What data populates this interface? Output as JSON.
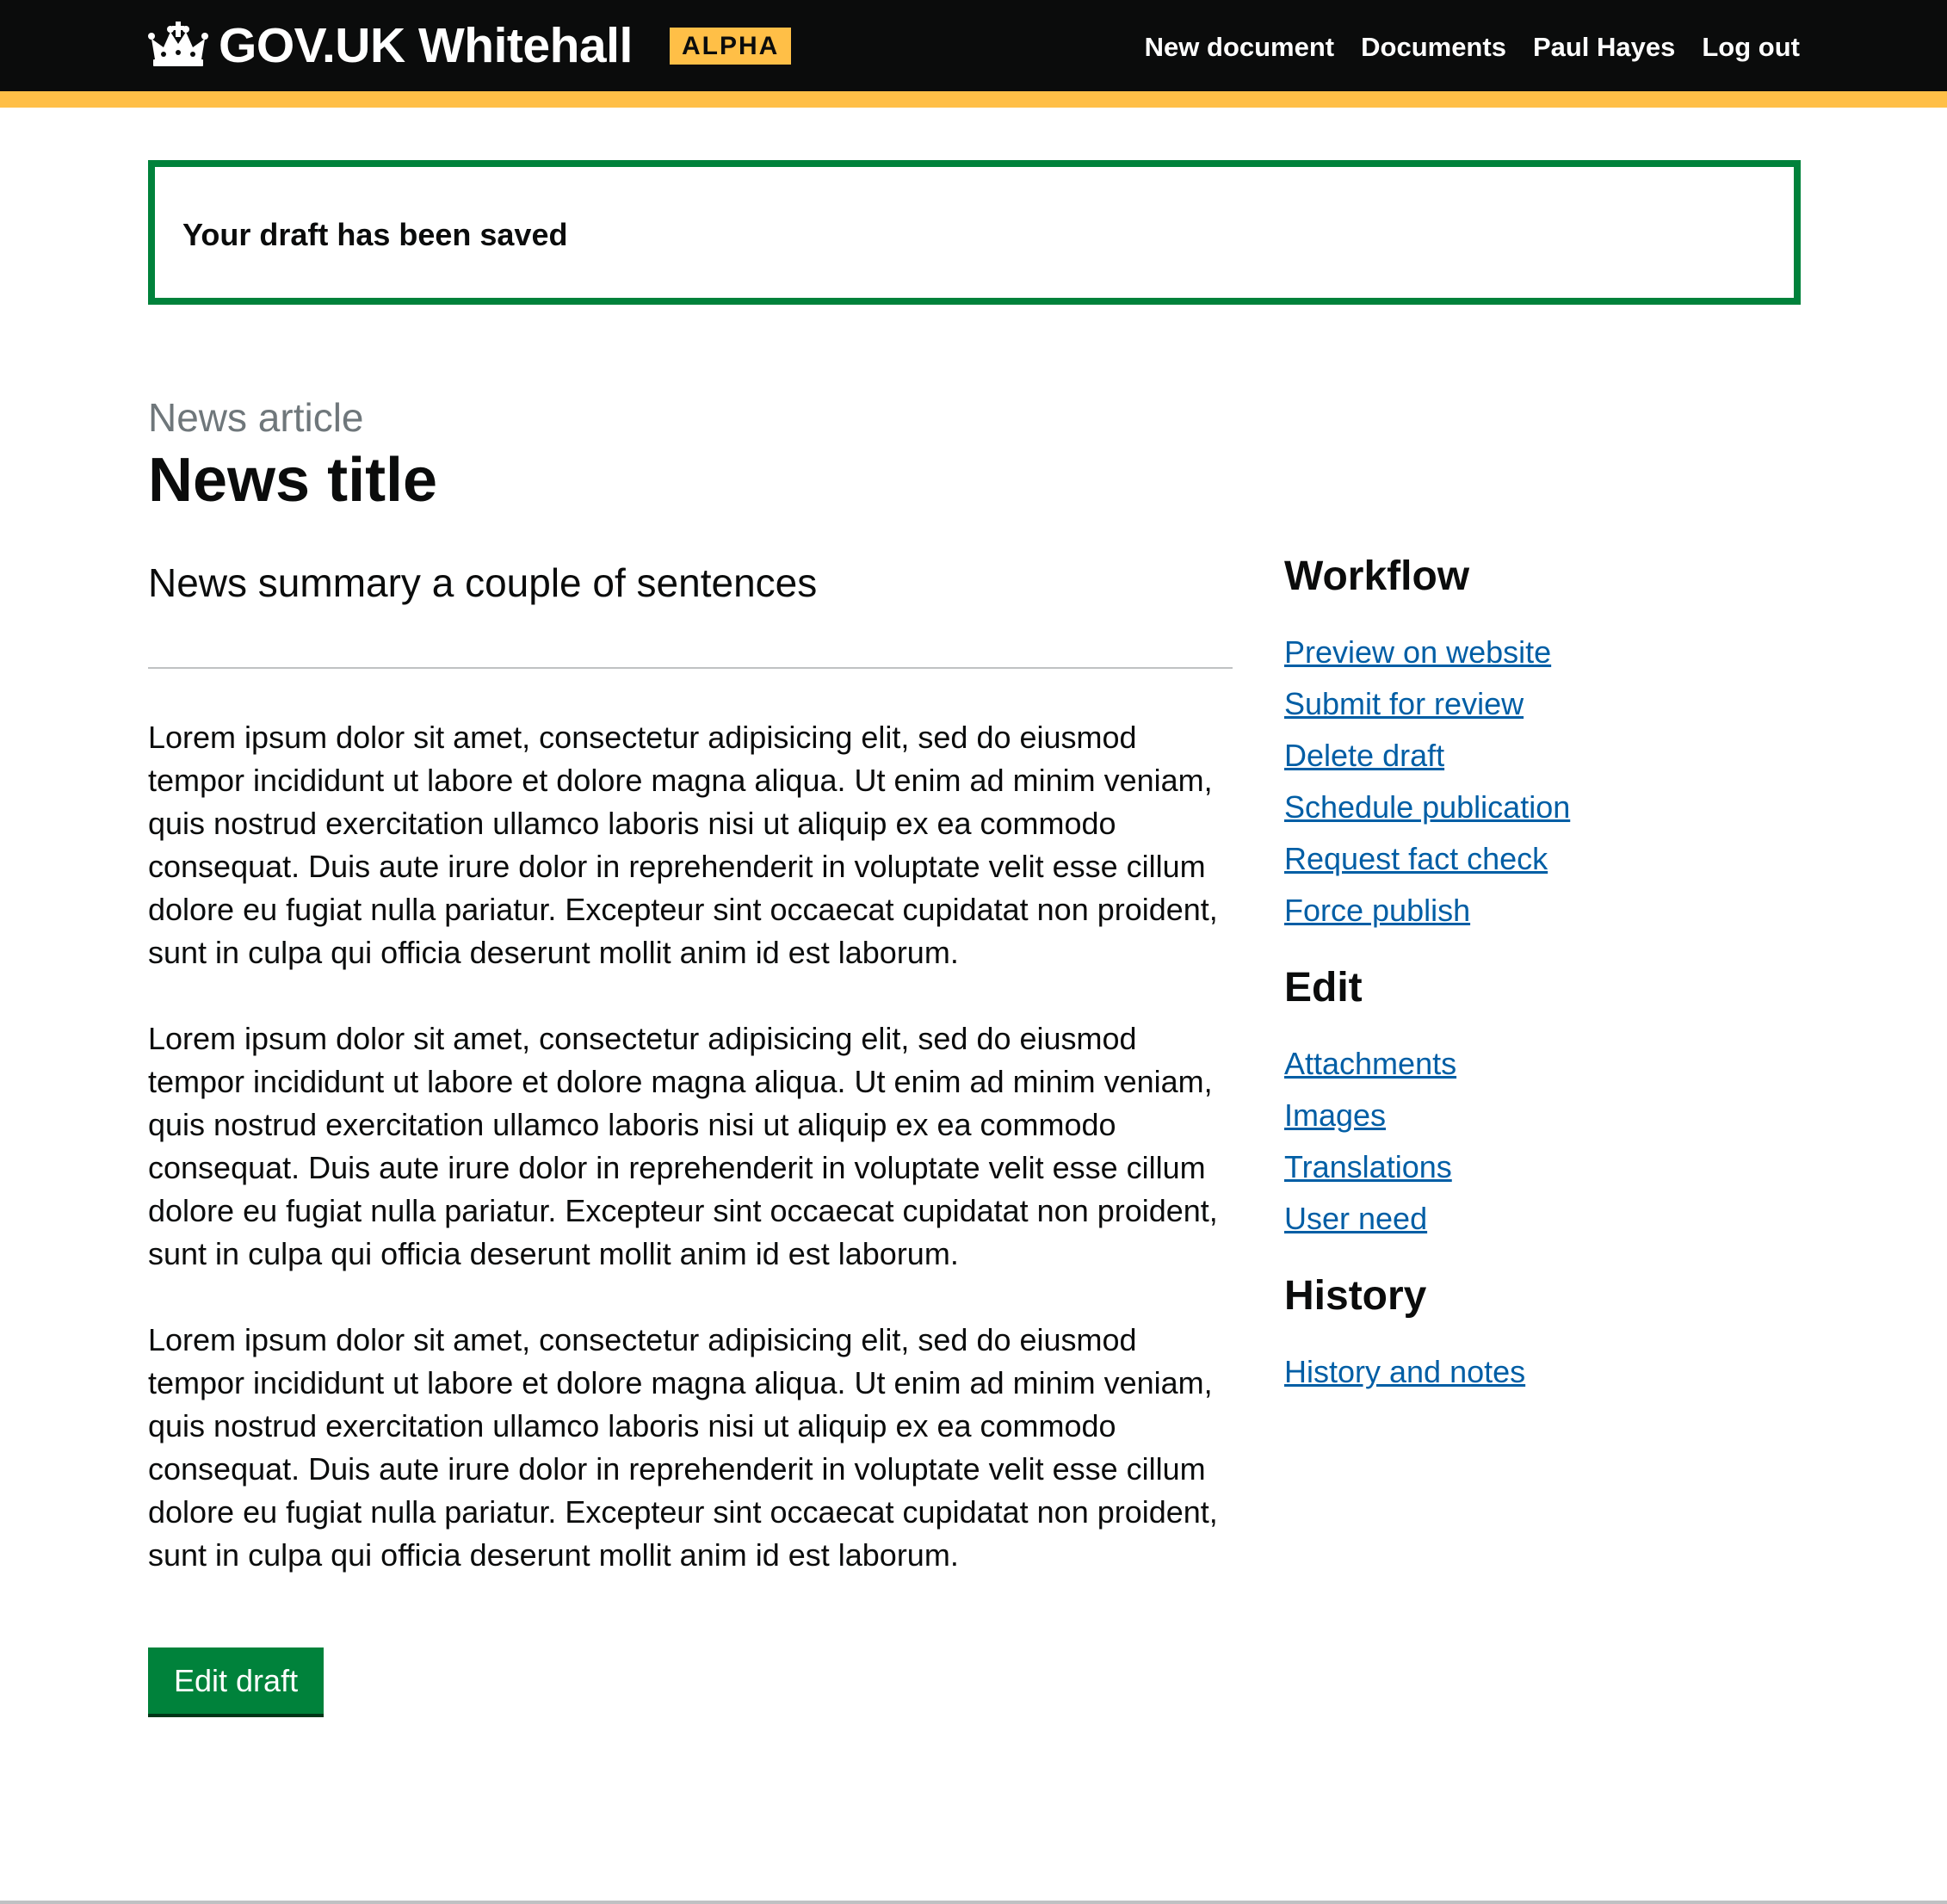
{
  "header": {
    "logo_text": "GOV.UK Whitehall",
    "phase_tag": "ALPHA",
    "nav": {
      "new_document": "New document",
      "documents": "Documents",
      "user": "Paul Hayes",
      "logout": "Log out"
    },
    "colors": {
      "background": "#0b0c0c",
      "stripe": "#ffbf47"
    }
  },
  "notice": {
    "text": "Your draft has been saved",
    "border_color": "#00823b"
  },
  "main": {
    "caption": "News article",
    "title": "News title",
    "summary": "News summary a couple of sentences",
    "paragraphs": [
      "Lorem ipsum dolor sit amet, consectetur adipisicing elit, sed do eiusmod tempor incididunt ut labore et dolore magna aliqua. Ut enim ad minim veniam, quis nostrud exercitation ullamco laboris nisi ut aliquip ex ea commodo consequat. Duis aute irure dolor in reprehenderit in voluptate velit esse cillum dolore eu fugiat nulla pariatur. Excepteur sint occaecat cupidatat non proident, sunt in culpa qui officia deserunt mollit anim id est laborum.",
      "Lorem ipsum dolor sit amet, consectetur adipisicing elit, sed do eiusmod tempor incididunt ut labore et dolore magna aliqua. Ut enim ad minim veniam, quis nostrud exercitation ullamco laboris nisi ut aliquip ex ea commodo consequat. Duis aute irure dolor in reprehenderit in voluptate velit esse cillum dolore eu fugiat nulla pariatur. Excepteur sint occaecat cupidatat non proident, sunt in culpa qui officia deserunt mollit anim id est laborum.",
      "Lorem ipsum dolor sit amet, consectetur adipisicing elit, sed do eiusmod tempor incididunt ut labore et dolore magna aliqua. Ut enim ad minim veniam, quis nostrud exercitation ullamco laboris nisi ut aliquip ex ea commodo consequat. Duis aute irure dolor in reprehenderit in voluptate velit esse cillum dolore eu fugiat nulla pariatur. Excepteur sint occaecat cupidatat non proident, sunt in culpa qui officia deserunt mollit anim id est laborum."
    ],
    "edit_button": "Edit draft",
    "button_color": "#00823b"
  },
  "sidebar": {
    "workflow": {
      "heading": "Workflow",
      "links": [
        "Preview on website",
        "Submit for review",
        "Delete draft",
        "Schedule publication",
        "Request fact check",
        "Force publish"
      ]
    },
    "edit": {
      "heading": "Edit",
      "links": [
        "Attachments",
        "Images",
        "Translations",
        "User need"
      ]
    },
    "history": {
      "heading": "History",
      "links": [
        "History and notes"
      ]
    },
    "link_color": "#005ea5"
  }
}
